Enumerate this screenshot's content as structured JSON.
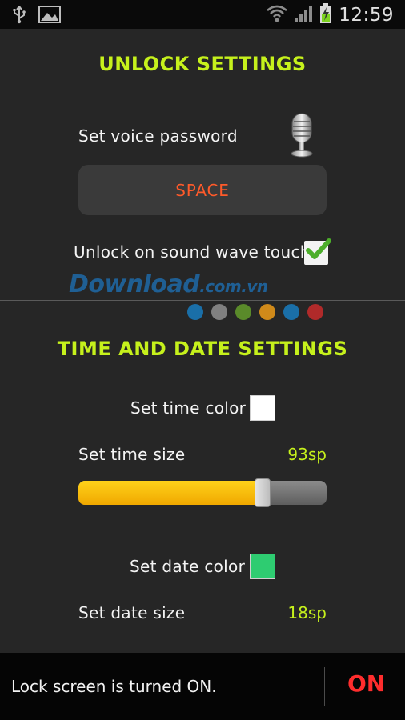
{
  "status_bar": {
    "time": "12:59",
    "icons": [
      "usb-icon",
      "image-icon",
      "wifi-icon",
      "signal-icon",
      "battery-charging-icon"
    ]
  },
  "unlock_settings": {
    "title": "UNLOCK SETTINGS",
    "voice_password_label": "Set voice password",
    "voice_icon": "microphone-icon",
    "space_button_label": "SPACE",
    "sound_wave_label": "Unlock on sound wave touch",
    "sound_wave_checked": true
  },
  "watermark": {
    "text": "Download",
    "domain": ".com.vn",
    "dot_colors": [
      "#1a6fa8",
      "#808080",
      "#5a8a2a",
      "#d08a1a",
      "#1a6fa8",
      "#b02a2a"
    ]
  },
  "time_date_settings": {
    "title": "TIME AND DATE SETTINGS",
    "time_color_label": "Set time color",
    "time_color": "#ffffff",
    "time_size_label": "Set time size",
    "time_size_value": "93sp",
    "time_size_fraction": 0.76,
    "date_color_label": "Set date color",
    "date_color": "#2ecc71",
    "date_size_label": "Set date size",
    "date_size_value": "18sp"
  },
  "bottom_bar": {
    "status_text": "Lock screen is turned ON.",
    "toggle_label": "ON"
  },
  "colors": {
    "accent": "#c6f11c",
    "space_text": "#ff5a2a",
    "on_text": "#ff2d2d",
    "slider_fill": "#f5b800"
  }
}
